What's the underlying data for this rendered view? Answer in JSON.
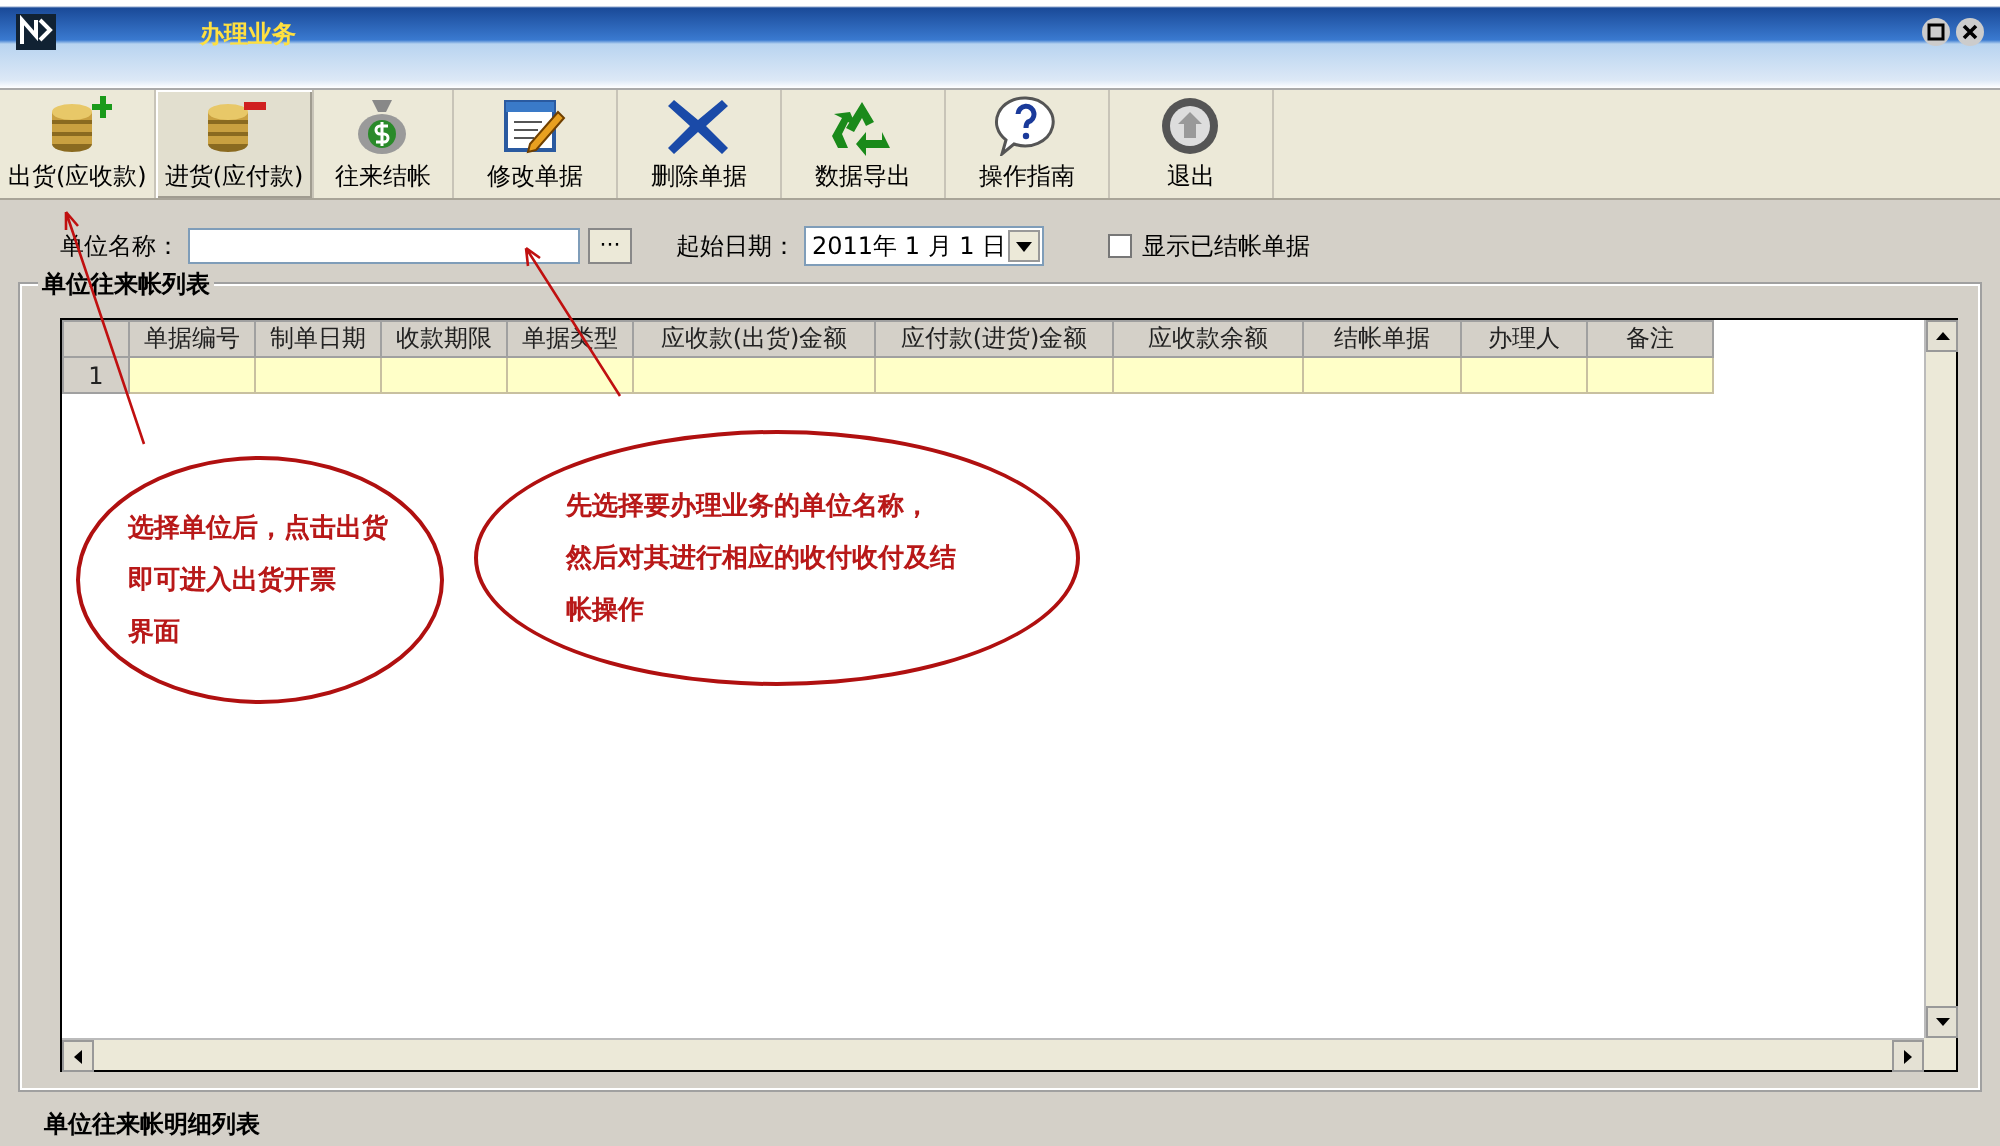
{
  "window": {
    "title": "办理业务"
  },
  "toolbar": {
    "buttons": [
      {
        "kind": "coins-plus",
        "label": "出货(应收款)",
        "selected": false
      },
      {
        "kind": "coins-minus",
        "label": "进货(应付款)",
        "selected": true
      },
      {
        "kind": "money-bag",
        "label": "往来结帐",
        "selected": false
      },
      {
        "kind": "edit",
        "label": "修改单据",
        "selected": false
      },
      {
        "kind": "delete",
        "label": "删除单据",
        "selected": false
      },
      {
        "kind": "recycle",
        "label": "数据导出",
        "selected": false
      },
      {
        "kind": "help",
        "label": "操作指南",
        "selected": false
      },
      {
        "kind": "exit",
        "label": "退出",
        "selected": false
      }
    ]
  },
  "filter": {
    "unit_label": "单位名称：",
    "browse_button": "···",
    "date_label": "起始日期：",
    "date_value": "2011年 1 月 1 日",
    "show_closed": {
      "label": "显示已结帐单据",
      "checked": false
    }
  },
  "group": {
    "title": "单位往来帐列表"
  },
  "table": {
    "columns": [
      "单据编号",
      "制单日期",
      "收款期限",
      "单据类型",
      "应收款(出货)金额",
      "应付款(进货)金额",
      "应收款余额",
      "结帐单据",
      "办理人",
      "备注"
    ],
    "rows": [
      {
        "number": "1",
        "selected": true
      }
    ]
  },
  "annotations": [
    {
      "lines": [
        "选择单位后，点击出货",
        "即可进入出货开票",
        "界面"
      ]
    },
    {
      "lines": [
        "先选择要办理业务的单位名称，",
        "然后对其进行相应的收付收付及结",
        "帐操作"
      ]
    }
  ],
  "bottom_section": {
    "title": "单位往来帐明细列表"
  }
}
